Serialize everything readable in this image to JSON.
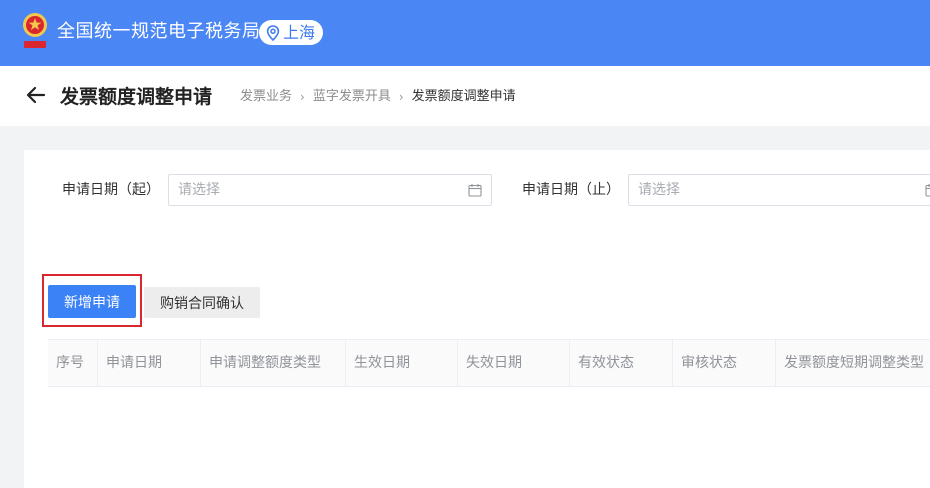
{
  "header": {
    "brand_title": "全国统一规范电子税务局",
    "location": "上海",
    "emblem": "national-emblem-icon",
    "brand_color": "#4b86f5"
  },
  "page": {
    "title": "发票额度调整申请",
    "breadcrumb": [
      "发票业务",
      "蓝字发票开具",
      "发票额度调整申请"
    ]
  },
  "filters": {
    "start_date": {
      "label": "申请日期（起）",
      "placeholder": "请选择",
      "value": ""
    },
    "end_date": {
      "label": "申请日期（止）",
      "placeholder": "请选择",
      "value": ""
    }
  },
  "actions": {
    "new_application": "新增申请",
    "contract_confirm": "购销合同确认",
    "primary_color": "#3b82f6",
    "highlight_color": "#d9262f"
  },
  "table": {
    "columns": [
      "序号",
      "申请日期",
      "申请调整额度类型",
      "生效日期",
      "失效日期",
      "有效状态",
      "审核状态",
      "发票额度短期调整类型"
    ],
    "rows": []
  }
}
